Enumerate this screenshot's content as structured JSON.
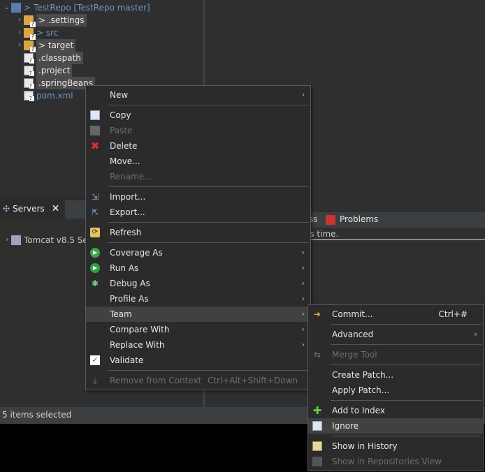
{
  "explorer": {
    "repo": {
      "label": "> TestRepo [TestRepo master]"
    },
    "items": [
      {
        "label": "> .settings",
        "kind": "folder",
        "selected": true
      },
      {
        "label": "> src",
        "kind": "folder",
        "selected": false
      },
      {
        "label": "> target",
        "kind": "folder",
        "selected": true
      },
      {
        "label": ".classpath",
        "kind": "file",
        "selected": true
      },
      {
        "label": ".project",
        "kind": "file",
        "selected": true
      },
      {
        "label": ".springBeans",
        "kind": "file",
        "selected": true
      },
      {
        "label": "pom.xml",
        "kind": "file",
        "selected": false
      }
    ]
  },
  "servers": {
    "tab_label": "Servers",
    "item": "Tomcat v8.5 Se"
  },
  "right_lower": {
    "tab_partial": "ss",
    "problems_tab": "Problems",
    "message_partial": "is time."
  },
  "status": {
    "text": "5 items selected"
  },
  "context_menu": {
    "new": "New",
    "copy": "Copy",
    "paste": "Paste",
    "delete": "Delete",
    "move": "Move...",
    "rename": "Rename...",
    "import": "Import...",
    "export": "Export...",
    "refresh": "Refresh",
    "coverage_as": "Coverage As",
    "run_as": "Run As",
    "debug_as": "Debug As",
    "profile_as": "Profile As",
    "team": "Team",
    "compare_with": "Compare With",
    "replace_with": "Replace With",
    "validate": "Validate",
    "remove_from_context": "Remove from Context",
    "remove_shortcut": "Ctrl+Alt+Shift+Down"
  },
  "team_menu": {
    "commit": "Commit...",
    "commit_shortcut": "Ctrl+#",
    "advanced": "Advanced",
    "merge_tool": "Merge Tool",
    "create_patch": "Create Patch...",
    "apply_patch": "Apply Patch...",
    "add_to_index": "Add to Index",
    "ignore": "Ignore",
    "show_in_history": "Show in History",
    "show_in_repositories": "Show in Repositories View"
  },
  "colors": {
    "accent_link": "#6b97c7",
    "menu_bg": "#2b2b2b",
    "highlight": "#414141",
    "status_bar": "#3c3f41"
  }
}
